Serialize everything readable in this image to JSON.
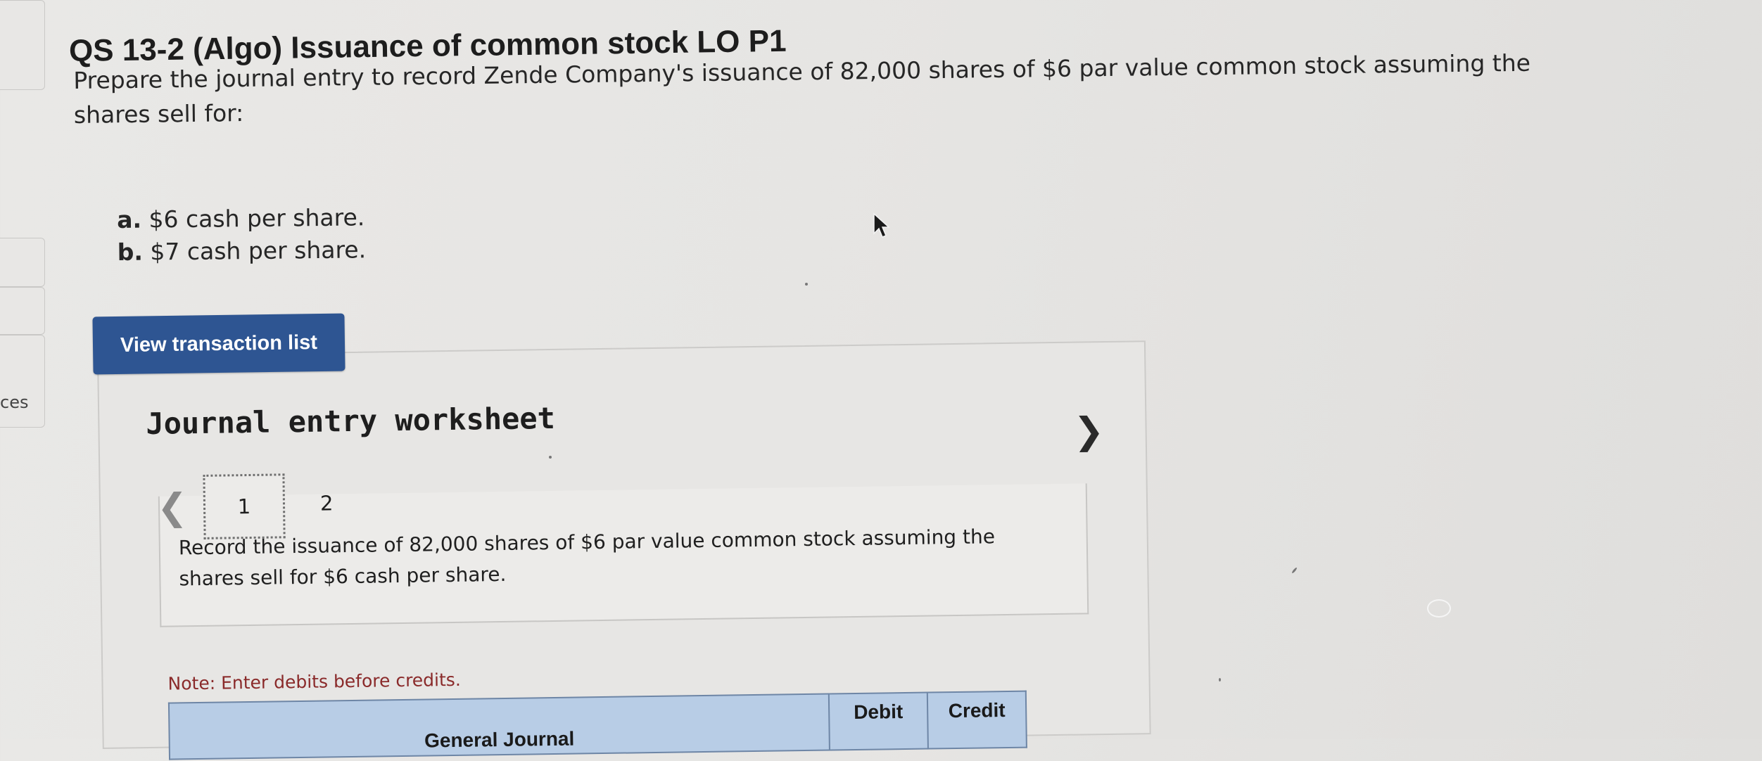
{
  "sidebar": {
    "label": "ces"
  },
  "question": {
    "title": "QS 13-2 (Algo) Issuance of common stock LO P1",
    "prompt": "Prepare the journal entry to record Zende Company's issuance of 82,000 shares of $6 par value common stock assuming the shares sell for:",
    "parts": [
      {
        "letter": "a.",
        "text": "$6 cash per share."
      },
      {
        "letter": "b.",
        "text": "$7 cash per share."
      }
    ]
  },
  "buttons": {
    "view_transaction_list": "View transaction list"
  },
  "worksheet": {
    "title": "Journal entry worksheet",
    "prev_icon": "chevron-left-icon",
    "next_icon": "chevron-right-icon",
    "steps": [
      "1",
      "2"
    ],
    "active_step": "1",
    "instruction": "Record the issuance of 82,000 shares of $6 par value common stock assuming the shares sell for $6 cash per share.",
    "note": "Note: Enter debits before credits.",
    "table_headers": {
      "general_journal": "General Journal",
      "debit": "Debit",
      "credit": "Credit"
    }
  },
  "colors": {
    "button_bg": "#2e5592",
    "table_header_bg": "#b8cde6",
    "note_text": "#8a2a2a"
  }
}
